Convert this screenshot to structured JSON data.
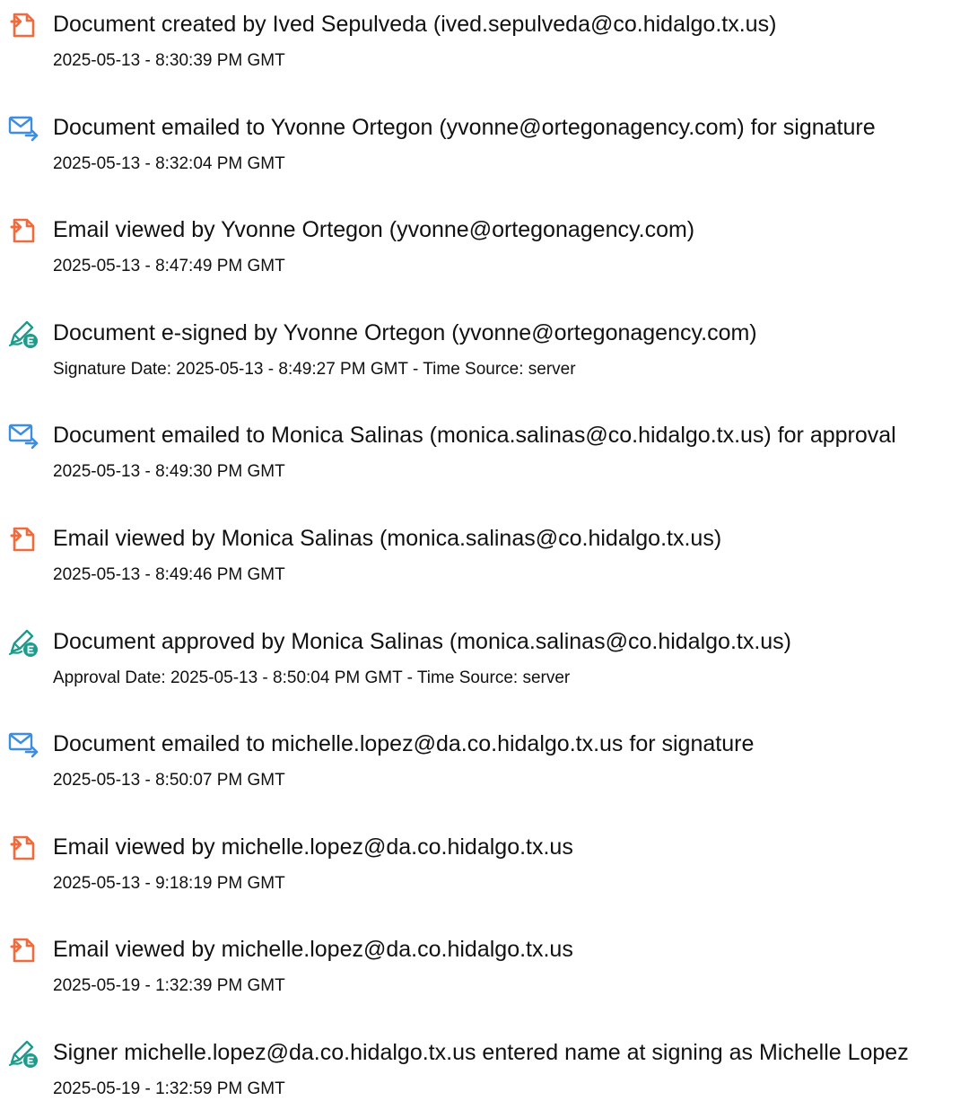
{
  "colors": {
    "doc_icon": "#f26a3b",
    "mail_icon": "#3d8ee0",
    "sign_icon": "#1d9b8c"
  },
  "events": [
    {
      "icon": "document-icon",
      "message": "Document created by Ived Sepulveda (ived.sepulveda@co.hidalgo.tx.us)",
      "detail": "2025-05-13 - 8:30:39 PM GMT"
    },
    {
      "icon": "email-sent-icon",
      "message": "Document emailed to Yvonne Ortegon (yvonne@ortegonagency.com) for signature",
      "detail": "2025-05-13 - 8:32:04 PM GMT"
    },
    {
      "icon": "document-icon",
      "message": "Email viewed by Yvonne Ortegon (yvonne@ortegonagency.com)",
      "detail": "2025-05-13 - 8:47:49 PM GMT"
    },
    {
      "icon": "esign-pen-icon",
      "message": "Document e-signed by Yvonne Ortegon (yvonne@ortegonagency.com)",
      "detail": "Signature Date: 2025-05-13 - 8:49:27 PM GMT - Time Source: server"
    },
    {
      "icon": "email-sent-icon",
      "message": "Document emailed to Monica Salinas (monica.salinas@co.hidalgo.tx.us) for approval",
      "detail": "2025-05-13 - 8:49:30 PM GMT"
    },
    {
      "icon": "document-icon",
      "message": "Email viewed by Monica Salinas (monica.salinas@co.hidalgo.tx.us)",
      "detail": "2025-05-13 - 8:49:46 PM GMT"
    },
    {
      "icon": "esign-pen-icon",
      "message": "Document approved by Monica Salinas (monica.salinas@co.hidalgo.tx.us)",
      "detail": "Approval Date: 2025-05-13 - 8:50:04 PM GMT - Time Source: server"
    },
    {
      "icon": "email-sent-icon",
      "message": "Document emailed to michelle.lopez@da.co.hidalgo.tx.us for signature",
      "detail": "2025-05-13 - 8:50:07 PM GMT"
    },
    {
      "icon": "document-icon",
      "message": "Email viewed by michelle.lopez@da.co.hidalgo.tx.us",
      "detail": "2025-05-13 - 9:18:19 PM GMT"
    },
    {
      "icon": "document-icon",
      "message": "Email viewed by michelle.lopez@da.co.hidalgo.tx.us",
      "detail": "2025-05-19 - 1:32:39 PM GMT"
    },
    {
      "icon": "esign-pen-icon",
      "message": "Signer michelle.lopez@da.co.hidalgo.tx.us entered name at signing as Michelle Lopez",
      "detail": "2025-05-19 - 1:32:59 PM GMT"
    }
  ]
}
